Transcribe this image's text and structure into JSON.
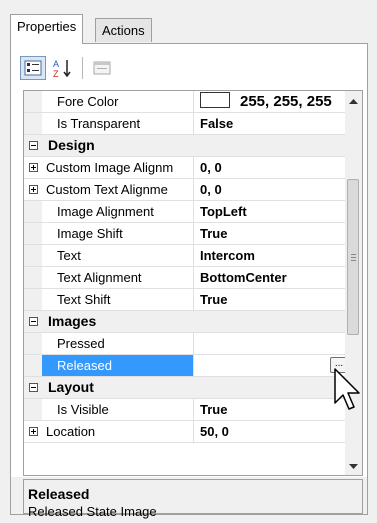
{
  "tabs": [
    {
      "label": "Properties",
      "active": true
    },
    {
      "label": "Actions",
      "active": false
    }
  ],
  "toolbar": {
    "buttons": [
      "categorized-icon",
      "alphabetical-sort-icon",
      "property-pages-icon"
    ]
  },
  "grid": {
    "rows": [
      {
        "type": "prop",
        "name": "Fore Color",
        "value": "255, 255, 255",
        "swatch": "#ffffff"
      },
      {
        "type": "prop",
        "name": "Is Transparent",
        "value": "False"
      },
      {
        "type": "cat",
        "name": "Design"
      },
      {
        "type": "sub",
        "name": "Custom Image Alignm",
        "value": "0, 0"
      },
      {
        "type": "sub",
        "name": "Custom Text Alignme",
        "value": "0, 0"
      },
      {
        "type": "prop",
        "name": "Image Alignment",
        "value": "TopLeft"
      },
      {
        "type": "prop",
        "name": "Image Shift",
        "value": "True"
      },
      {
        "type": "prop",
        "name": "Text",
        "value": "Intercom"
      },
      {
        "type": "prop",
        "name": "Text Alignment",
        "value": "BottomCenter"
      },
      {
        "type": "prop",
        "name": "Text Shift",
        "value": "True"
      },
      {
        "type": "cat",
        "name": "Images"
      },
      {
        "type": "prop",
        "name": "Pressed",
        "value": ""
      },
      {
        "type": "prop",
        "name": "Released",
        "value": "",
        "selected": true,
        "ellipsis": "..."
      },
      {
        "type": "cat",
        "name": "Layout"
      },
      {
        "type": "prop",
        "name": "Is Visible",
        "value": "True"
      },
      {
        "type": "sub",
        "name": "Location",
        "value": "50, 0"
      }
    ]
  },
  "description": {
    "title": "Released",
    "text": "Released State Image"
  },
  "colors": {
    "selection": "#3399ff",
    "category_bg": "#f0f0f0"
  }
}
